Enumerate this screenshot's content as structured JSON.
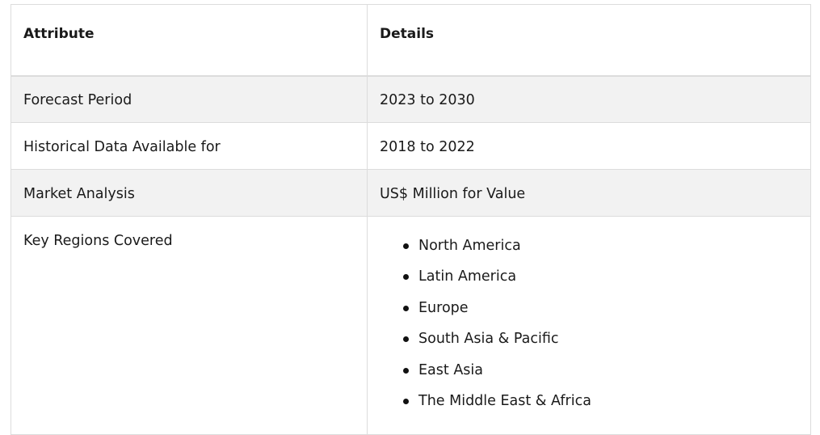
{
  "table": {
    "headers": {
      "attribute": "Attribute",
      "details": "Details"
    },
    "rows": [
      {
        "attribute": "Forecast Period",
        "details": "2023 to 2030"
      },
      {
        "attribute": "Historical Data Available for",
        "details": "2018 to 2022"
      },
      {
        "attribute": "Market Analysis",
        "details": "US$ Million for Value"
      },
      {
        "attribute": "Key Regions Covered",
        "regions": [
          "North America",
          "Latin America",
          "Europe",
          "South Asia & Pacific",
          "East Asia",
          "The Middle East & Africa"
        ]
      }
    ]
  }
}
